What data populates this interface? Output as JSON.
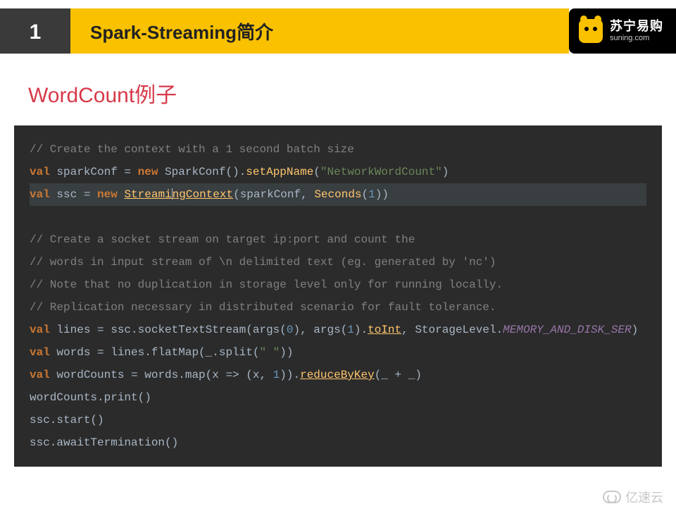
{
  "header": {
    "section_number": "1",
    "title": "Spark-Streaming简介",
    "logo_cn": "苏宁易购",
    "logo_en": "suning.com"
  },
  "subtitle": "WordCount例子",
  "code": {
    "l1_comment": "// Create the context with a 1 second batch size",
    "l2_val": "val",
    "l2_id": " sparkConf = ",
    "l2_new": "new",
    "l2_cls": " SparkConf().",
    "l2_fn": "setAppName",
    "l2_paren_o": "(",
    "l2_str": "\"NetworkWordCount\"",
    "l2_paren_c": ")",
    "l3_val": "val",
    "l3_id": " ssc = ",
    "l3_new": "new",
    "l3_space": " ",
    "l3_cls_a": "Streami",
    "l3_cls_b": "ngContext",
    "l3_args_a": "(sparkConf, ",
    "l3_fn": "Seconds",
    "l3_args_b": "(",
    "l3_num": "1",
    "l3_args_c": "))",
    "l4_blank": " ",
    "l5_comment": "// Create a socket stream on target ip:port and count the",
    "l6_comment": "// words in input stream of \\n delimited text (eg. generated by 'nc')",
    "l7_comment": "// Note that no duplication in storage level only for running locally.",
    "l8_comment": "// Replication necessary in distributed scenario for fault tolerance.",
    "l9_val": "val",
    "l9_a": " lines = ssc.socketTextStream(args(",
    "l9_n0": "0",
    "l9_b": "), args(",
    "l9_n1": "1",
    "l9_c": ").",
    "l9_fn": "toInt",
    "l9_d": ", StorageLevel.",
    "l9_em": "MEMORY_AND_DISK_SER",
    "l9_e": ")",
    "l10_val": "val",
    "l10_a": " words = lines.flatMap(_.split(",
    "l10_str": "\" \"",
    "l10_b": "))",
    "l11_val": "val",
    "l11_a": " wordCounts = words.map(x => (x, ",
    "l11_n1": "1",
    "l11_b": ")).",
    "l11_fn": "reduceByKey",
    "l11_c": "(_ + _)",
    "l12": "wordCounts.print()",
    "l13": "ssc.start()",
    "l14": "ssc.awaitTermination()"
  },
  "watermark": "亿速云"
}
